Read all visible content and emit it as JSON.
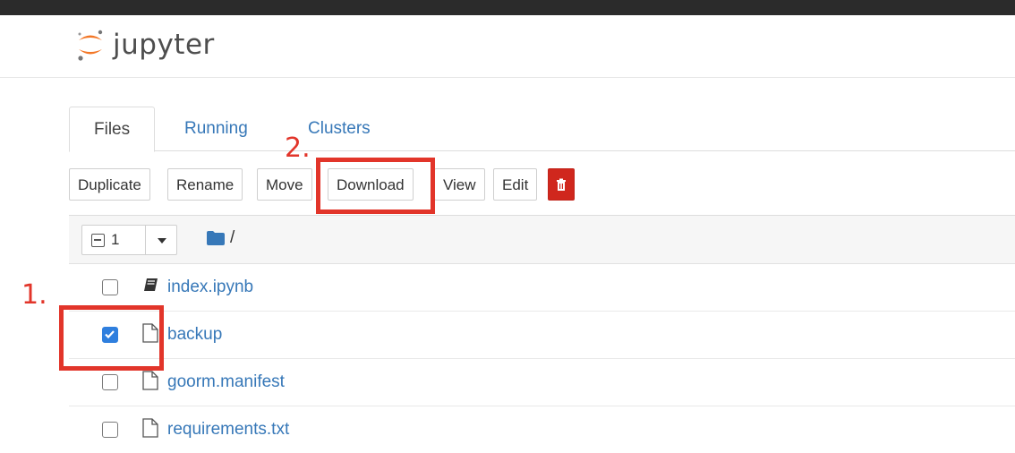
{
  "app": {
    "name": "jupyter"
  },
  "tabs": [
    {
      "label": "Files",
      "active": true
    },
    {
      "label": "Running",
      "active": false
    },
    {
      "label": "Clusters",
      "active": false
    }
  ],
  "toolbar": {
    "duplicate": "Duplicate",
    "rename": "Rename",
    "move": "Move",
    "download": "Download",
    "view": "View",
    "edit": "Edit",
    "delete_icon": "trash-icon"
  },
  "file_list": {
    "selected_count": "1",
    "path": "/",
    "items": [
      {
        "name": "index.ipynb",
        "type": "notebook",
        "checked": false
      },
      {
        "name": "backup",
        "type": "file",
        "checked": true
      },
      {
        "name": "goorm.manifest",
        "type": "file",
        "checked": false
      },
      {
        "name": "requirements.txt",
        "type": "file",
        "checked": false
      }
    ]
  },
  "annotations": {
    "step1": "1.",
    "step2": "2."
  },
  "colors": {
    "link": "#3778b8",
    "danger": "#d0271d",
    "annotation": "#e2352a",
    "checkbox": "#2f7fde"
  }
}
